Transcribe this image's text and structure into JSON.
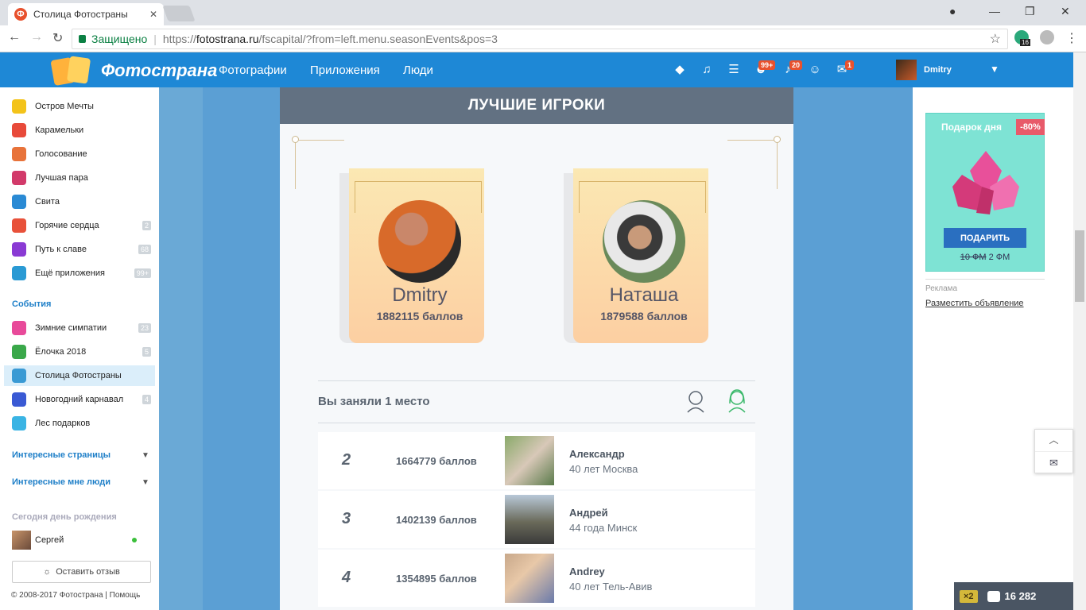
{
  "browser": {
    "tab_title": "Столица Фотостраны",
    "tab_favicon": "Ф",
    "secure_label": "Защищено",
    "url_scheme": "https://",
    "url_host": "fotostrana.ru",
    "url_path": "/fscapital/?from=left.menu.seasonEvents&pos=3",
    "extension_badge": "16"
  },
  "header": {
    "brand": "Фотострана",
    "nav": [
      "Фотографии",
      "Приложения",
      "Люди"
    ],
    "badges": {
      "friends": "99+",
      "notifications": "20",
      "messages": "1"
    },
    "user_name": "Dmitry"
  },
  "sidebar": {
    "apps": [
      {
        "label": "Остров Мечты",
        "count": "",
        "color": "#f3c31a",
        "icon": "star-icon"
      },
      {
        "label": "Карамельки",
        "count": "",
        "color": "#e84a3a",
        "icon": "candy-icon"
      },
      {
        "label": "Голосование",
        "count": "",
        "color": "#e8733a",
        "icon": "crown-icon"
      },
      {
        "label": "Лучшая пара",
        "count": "",
        "color": "#d23a6a",
        "icon": "heart-icon"
      },
      {
        "label": "Свита",
        "count": "",
        "color": "#2a8ad4",
        "icon": "crown-icon"
      },
      {
        "label": "Горячие сердца",
        "count": "2",
        "color": "#e8513a",
        "icon": "guitar-icon"
      },
      {
        "label": "Путь к славе",
        "count": "68",
        "color": "#8a3ad4",
        "icon": "star-icon"
      },
      {
        "label": "Ещё приложения",
        "count": "99+",
        "color": "#2a9ad4",
        "icon": "gamepad-icon"
      }
    ],
    "events_title": "События",
    "events": [
      {
        "label": "Зимние симпатии",
        "count": "23",
        "color": "#e84a9a",
        "icon": "heart-icon",
        "active": false
      },
      {
        "label": "Ёлочка 2018",
        "count": "5",
        "color": "#3aa84a",
        "icon": "tree-icon",
        "active": false
      },
      {
        "label": "Столица Фотостраны",
        "count": "",
        "color": "#3a9ad4",
        "icon": "snowflake-icon",
        "active": true
      },
      {
        "label": "Новогодний карнавал",
        "count": "4",
        "color": "#3a5ad4",
        "icon": "crown-icon",
        "active": false
      },
      {
        "label": "Лес подарков",
        "count": "",
        "color": "#3ab4e4",
        "icon": "paw-icon",
        "active": false
      }
    ],
    "interesting_pages": "Интересные страницы",
    "interesting_people": "Интересные мне люди",
    "birthday_title": "Сегодня день рождения",
    "birthday_user": "Сергей",
    "feedback_button": "Оставить отзыв",
    "copyright": "© 2008-2017 Фотострана",
    "help_link": "Помощь"
  },
  "main": {
    "title": "ЛУЧШИЕ ИГРОКИ",
    "winners": [
      {
        "name": "Dmitry",
        "score": "1882115 баллов"
      },
      {
        "name": "Наташа",
        "score": "1879588 баллов"
      }
    ],
    "your_rank": "Вы заняли 1 место",
    "rows": [
      {
        "rank": "2",
        "score": "1664779 баллов",
        "name": "Александр",
        "info": "40 лет Москва"
      },
      {
        "rank": "3",
        "score": "1402139 баллов",
        "name": "Андрей",
        "info": "44 года Минск"
      },
      {
        "rank": "4",
        "score": "1354895 баллов",
        "name": "Andrey",
        "info": "40 лет Тель-Авив"
      }
    ]
  },
  "right": {
    "gift_title": "Подарок дня",
    "discount": "-80%",
    "gift_button": "ПОДАРИТЬ",
    "old_price": "10 ФМ",
    "new_price": "2 ФМ",
    "ad_label": "Реклама",
    "ad_link": "Разместить объявление"
  },
  "bottom": {
    "multiplier": "×2",
    "coins": "16 282"
  }
}
